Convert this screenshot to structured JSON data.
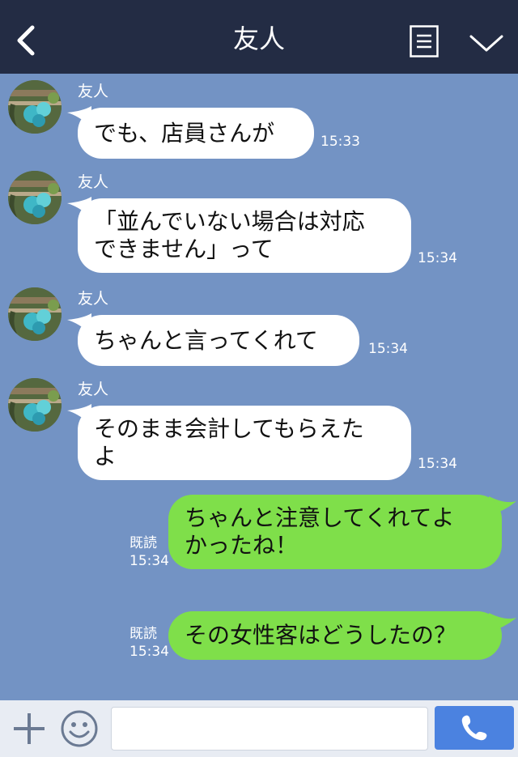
{
  "header": {
    "title": "友人",
    "back_icon": "chevron-left-icon",
    "menu_icon": "menu-list-icon",
    "collapse_icon": "chevron-down-icon"
  },
  "messages": [
    {
      "sender": "友人",
      "text": "でも、店員さんが",
      "time": "15:33"
    },
    {
      "sender": "友人",
      "text": "「並んでいない場合は対応\nできません」って",
      "time": "15:34"
    },
    {
      "sender": "友人",
      "text": "ちゃんと言ってくれて",
      "time": "15:34"
    },
    {
      "sender": "友人",
      "text": "そのまま会計してもらえた\nよ",
      "time": "15:34"
    },
    {
      "text": "ちゃんと注意してくれてよ\nかったね！",
      "read": "既読",
      "time": "15:34"
    },
    {
      "text": "その女性客はどうしたの？",
      "read": "既読",
      "time": "15:34"
    }
  ],
  "input_bar": {
    "add_icon": "plus-icon",
    "emoji_icon": "smiley-icon",
    "message_value": "",
    "call_icon": "phone-icon"
  },
  "colors": {
    "header_bg": "#232c44",
    "chat_bg": "#7393c4",
    "received_bubble": "#ffffff",
    "sent_bubble": "#7fdf4a",
    "call_button": "#4b82e0"
  }
}
